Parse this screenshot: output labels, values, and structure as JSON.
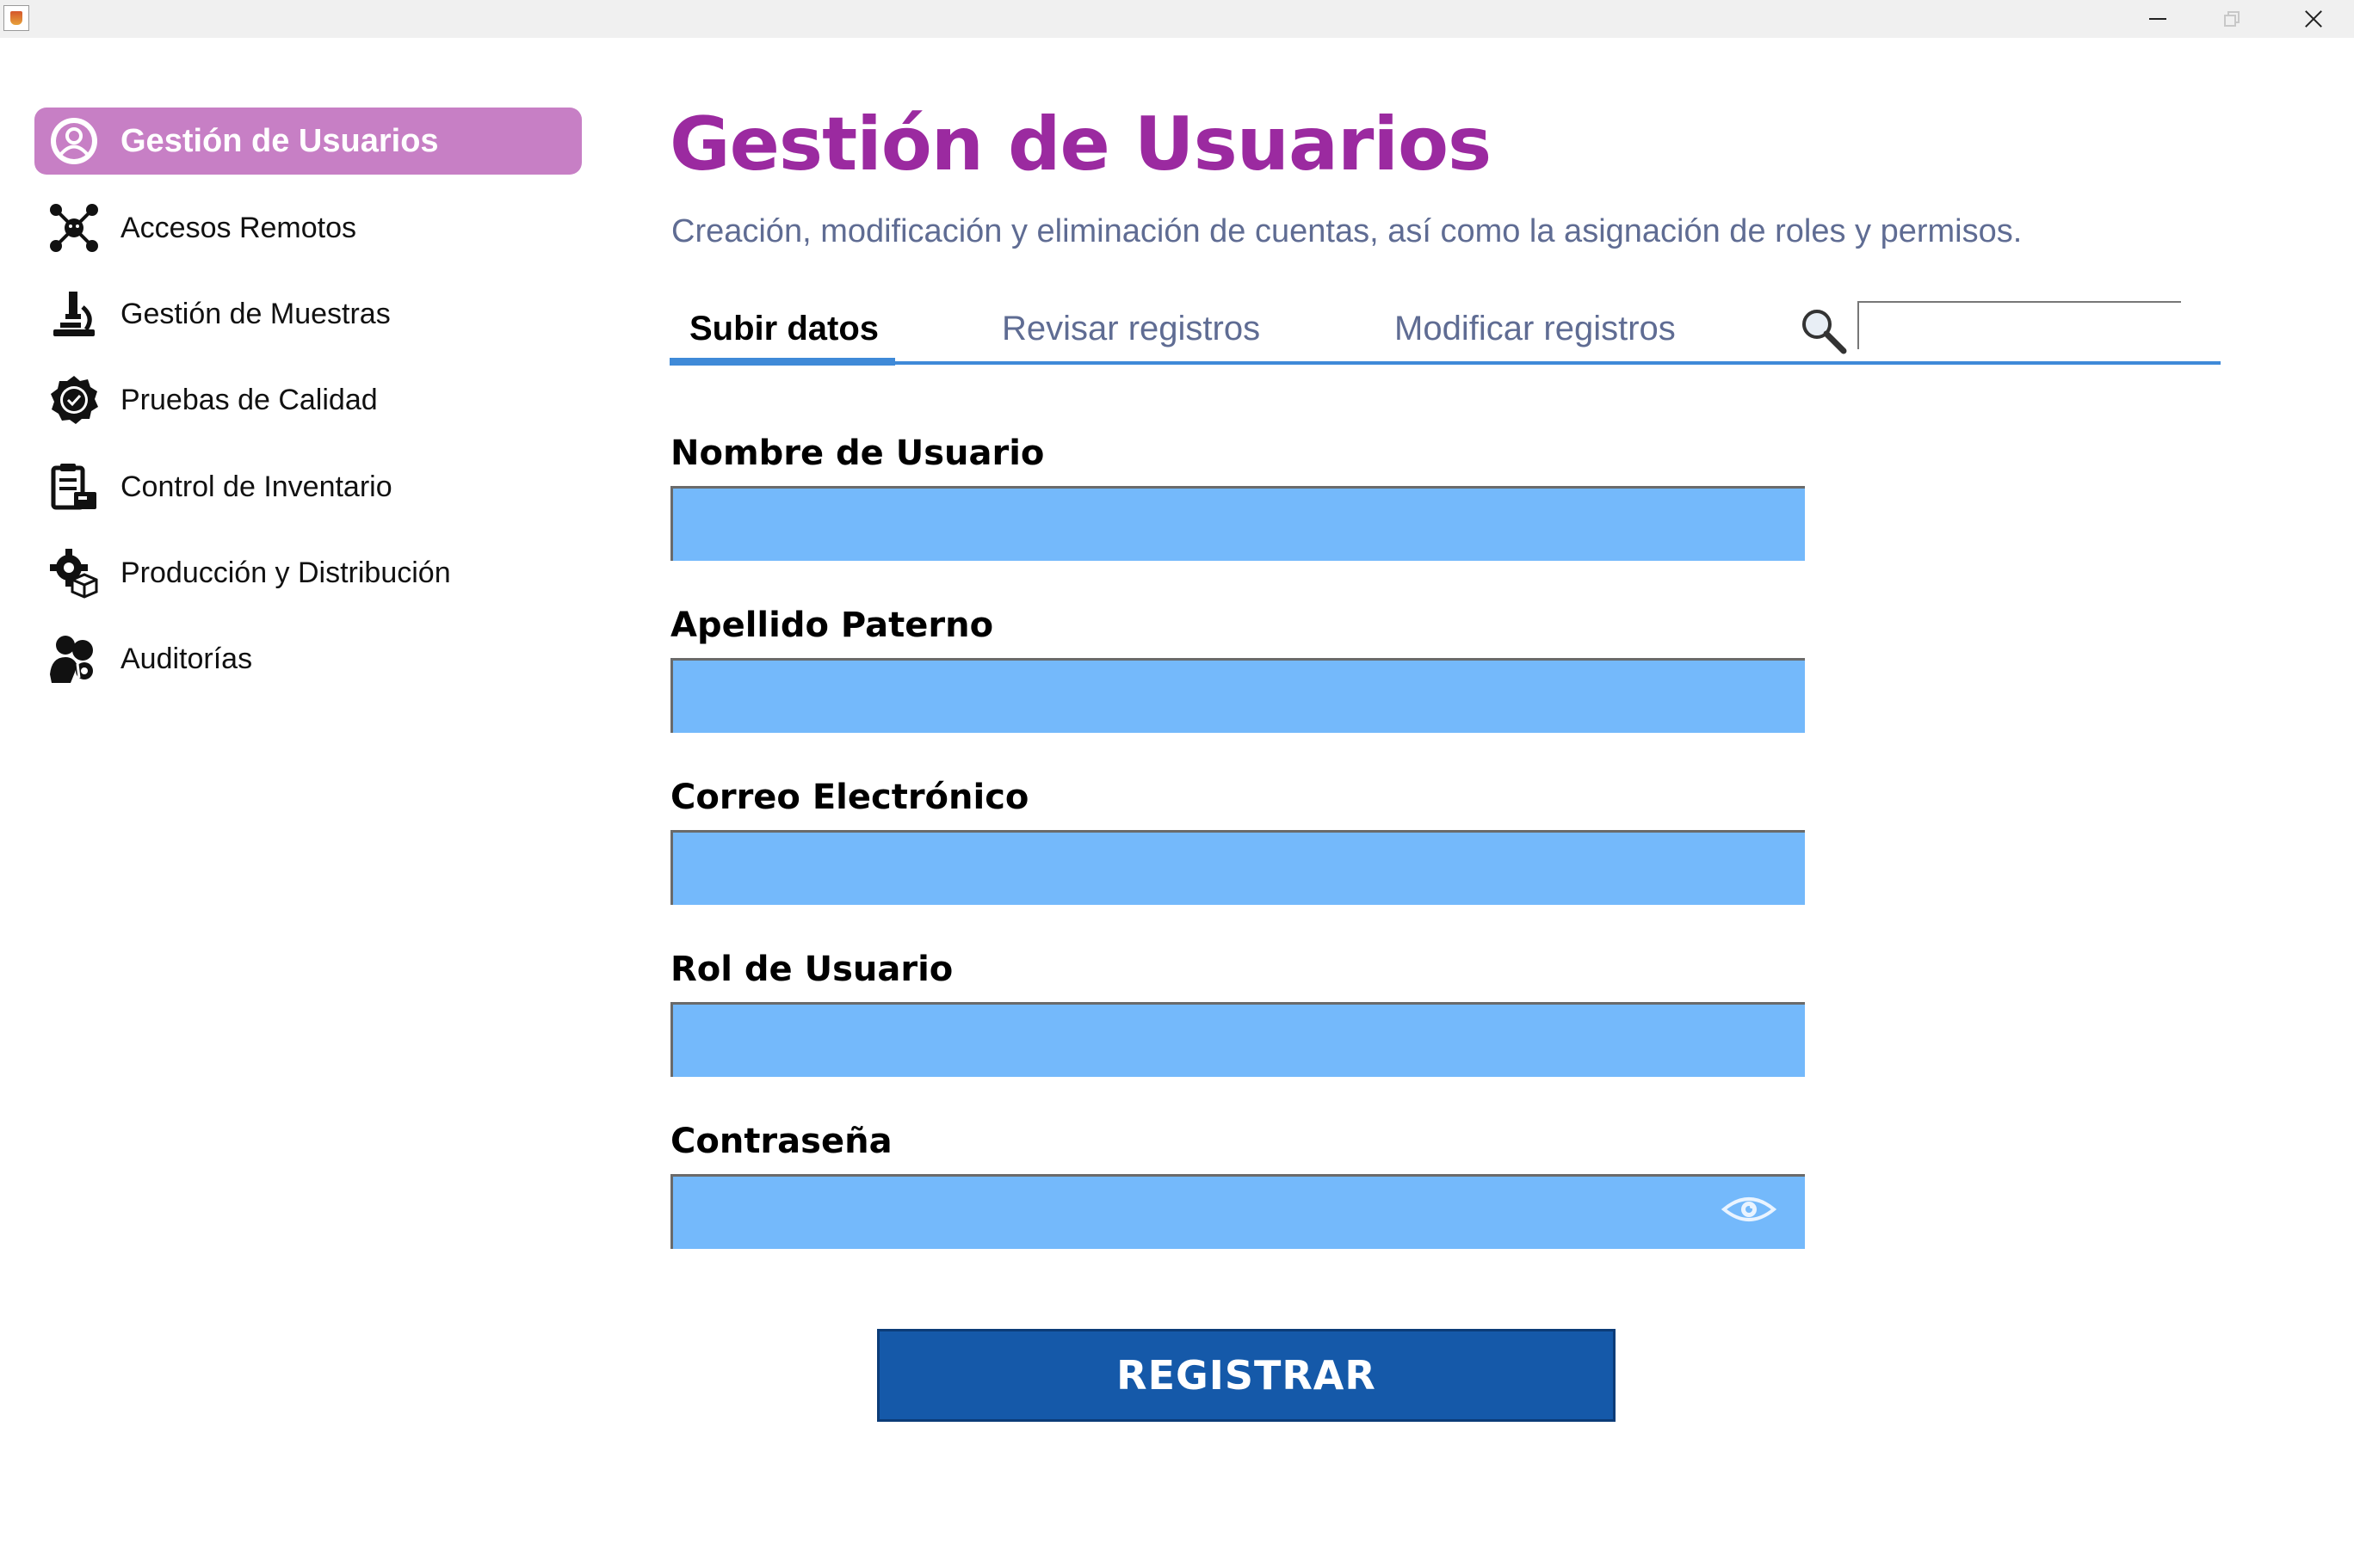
{
  "window": {
    "controls": [
      "minimize",
      "maximize",
      "close"
    ]
  },
  "sidebar": {
    "items": [
      {
        "label": "Gestión de Usuarios",
        "icon": "user-circle-icon",
        "active": true
      },
      {
        "label": "Accesos Remotos",
        "icon": "network-nodes-icon"
      },
      {
        "label": "Gestión de Muestras",
        "icon": "microscope-icon"
      },
      {
        "label": "Pruebas de Calidad",
        "icon": "quality-badge-icon"
      },
      {
        "label": "Control de Inventario",
        "icon": "clipboard-inventory-icon"
      },
      {
        "label": "Producción y Distribución",
        "icon": "gear-box-icon"
      },
      {
        "label": "Auditorías",
        "icon": "audit-people-icon"
      }
    ],
    "active_color": "#c77fc5"
  },
  "main": {
    "title": "Gestión de Usuarios",
    "subtitle": "Creación, modificación y eliminación de cuentas, así como la asignación de roles y permisos.",
    "tabs": [
      {
        "label": "Subir datos",
        "active": true
      },
      {
        "label": "Revisar registros"
      },
      {
        "label": "Modificar registros"
      }
    ],
    "search": {
      "icon": "search-icon",
      "value": ""
    },
    "form": {
      "fields": [
        {
          "label": "Nombre de Usuario",
          "value": ""
        },
        {
          "label": "Apellido Paterno",
          "value": ""
        },
        {
          "label": "Correo Electrónico",
          "value": ""
        },
        {
          "label": "Rol de Usuario",
          "value": ""
        },
        {
          "label": "Contraseña",
          "value": "",
          "icon": "eye-icon"
        }
      ],
      "submit_label": "REGISTRAR"
    }
  },
  "colors": {
    "title": "#9b2aa0",
    "subtitle": "#5f6c93",
    "input_bg": "#74b9fb",
    "tab_accent": "#3f8ad8",
    "button_bg": "#1559a9"
  }
}
